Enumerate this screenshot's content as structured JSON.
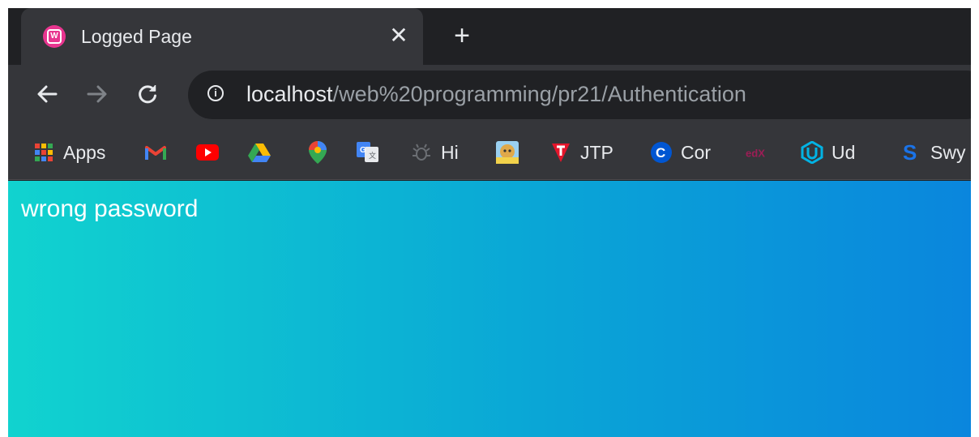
{
  "tab": {
    "title": "Logged Page",
    "favicon_letter": "W",
    "close_label": "✕"
  },
  "new_tab_label": "+",
  "address": {
    "host": "localhost",
    "path": "/web%20programming/pr21/Authentication"
  },
  "bookmarks": {
    "apps": "Apps",
    "hi": "Hi",
    "jtp": "JTP",
    "cor": "Cor",
    "ud": "Ud",
    "swy": "Swy",
    "edx": "edX"
  },
  "page": {
    "message": "wrong password"
  },
  "colors": {
    "favicon": "#e8358f",
    "gradient_start": "#11d3cf",
    "gradient_end": "#0a86dd"
  }
}
